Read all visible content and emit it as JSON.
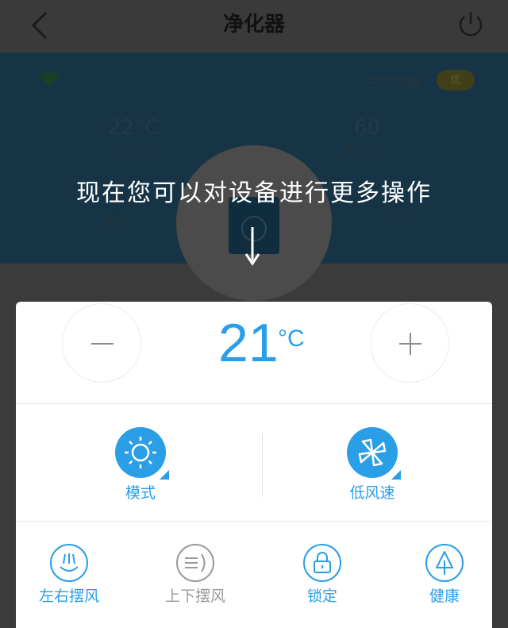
{
  "header": {
    "title": "净化器"
  },
  "status": {
    "air_quality_label": "空气质量",
    "air_quality_badge": "优",
    "temperature_value": "22°C",
    "temperature_label": "室温",
    "pm25_value": "60",
    "pm25_label": "PM2.5",
    "humidity_label": "湿度",
    "voc_label": "VOC"
  },
  "overlay": {
    "hint_text": "现在您可以对设备进行更多操作"
  },
  "control": {
    "temperature": "21",
    "unit": "°C",
    "mode_label": "模式",
    "fan_label": "低风速",
    "functions": [
      {
        "label": "左右摆风",
        "color": "#2a9ee7"
      },
      {
        "label": "上下摆风",
        "color": "#9a9a9a"
      },
      {
        "label": "锁定",
        "color": "#2a9ee7"
      },
      {
        "label": "健康",
        "color": "#2a9ee7"
      }
    ]
  },
  "colors": {
    "accent": "#2a9ee7",
    "inactive": "#9a9a9a"
  }
}
